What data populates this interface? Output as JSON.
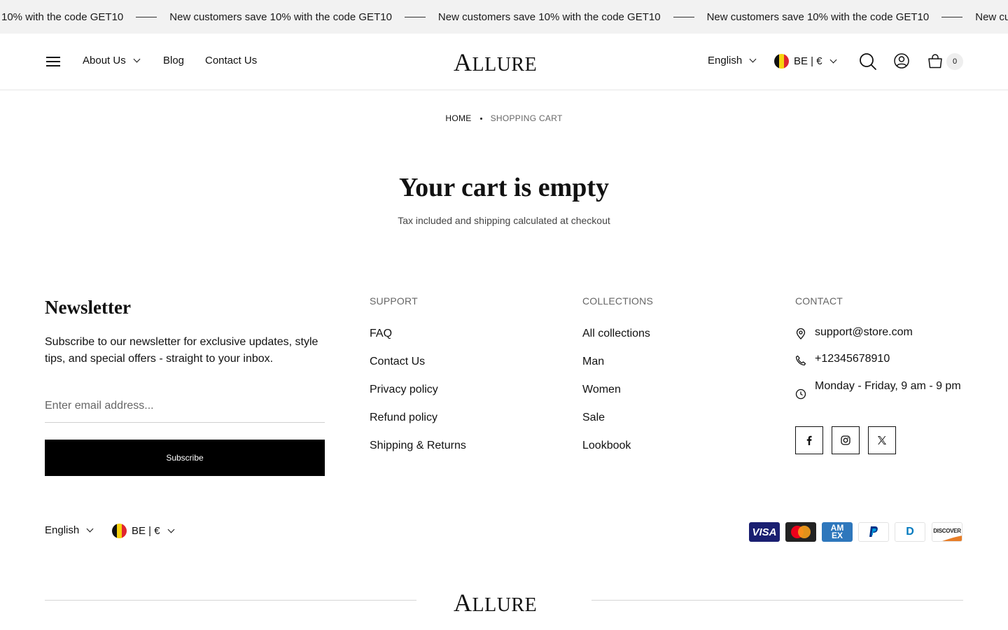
{
  "announcement": {
    "items": [
      "10% with the code GET10",
      "New customers save 10% with the code GET10",
      "New customers save 10% with the code GET10",
      "New customers save 10% with the code GET10",
      "New customers save 10% with the code GET10"
    ]
  },
  "header": {
    "nav": {
      "about": "About Us",
      "blog": "Blog",
      "contact": "Contact Us"
    },
    "logo": {
      "first": "A",
      "rest": "LLURE"
    },
    "language": "English",
    "currency": "BE | €",
    "cart_count": "0"
  },
  "breadcrumb": {
    "home": "HOME",
    "current": "SHOPPING CART"
  },
  "cart": {
    "title": "Your cart is empty",
    "subtitle": "Tax included and shipping calculated at checkout"
  },
  "newsletter": {
    "title": "Newsletter",
    "text": "Subscribe to our newsletter for exclusive updates, style tips, and special offers - straight to your inbox.",
    "placeholder": "Enter email address...",
    "button": "Subscribe"
  },
  "support": {
    "heading": "SUPPORT",
    "links": [
      "FAQ",
      "Contact Us",
      "Privacy policy",
      "Refund policy",
      "Shipping & Returns"
    ]
  },
  "collections": {
    "heading": "COLLECTIONS",
    "links": [
      "All collections",
      "Man",
      "Women",
      "Sale",
      "Lookbook"
    ]
  },
  "contact": {
    "heading": "CONTACT",
    "email": "support@store.com",
    "phone": "+12345678910",
    "hours": "Monday - Friday, 9 am - 9 pm"
  },
  "social": [
    "facebook-icon",
    "instagram-icon",
    "x-icon"
  ],
  "footer_bottom": {
    "language": "English",
    "currency": "BE | €"
  },
  "payments": {
    "visa": "VISA",
    "amex_line1": "AM",
    "amex_line2": "EX",
    "diners": "D",
    "discover": "DISCOVER"
  },
  "colors": {
    "announcement_bg": "#f2f2f2",
    "button_bg": "#000000",
    "visa": "#1a1f71",
    "amex": "#2e77bc",
    "paypal": "#003087",
    "diners": "#0079be",
    "discover": "#e77d27"
  }
}
